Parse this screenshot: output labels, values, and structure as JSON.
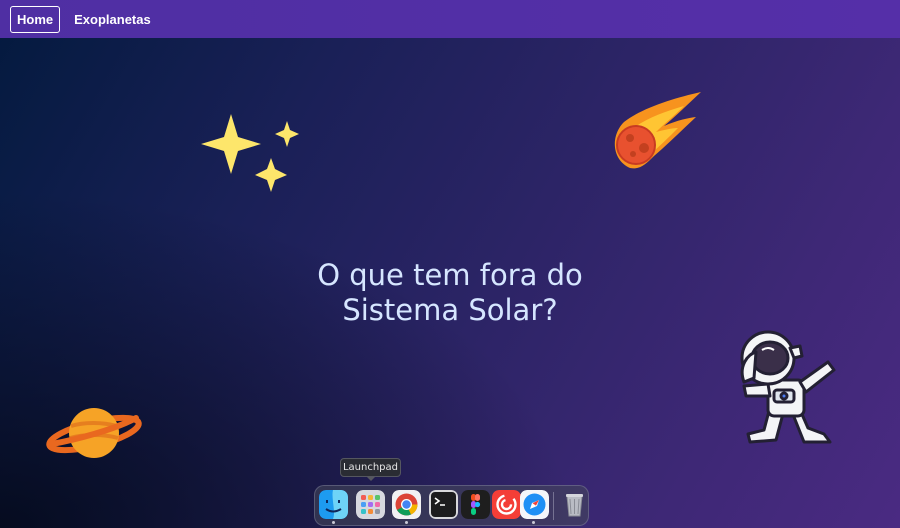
{
  "nav": {
    "home_label": "Home",
    "exoplanets_label": "Exoplanetas"
  },
  "hero": {
    "line1": "O que tem fora do",
    "line2": "Sistema Solar?"
  },
  "illustrations": [
    "sparkles-icon",
    "comet-icon",
    "saturn-icon",
    "astronaut-icon"
  ],
  "dock": {
    "tooltip": "Launchpad",
    "apps": [
      {
        "name": "Finder",
        "icon": "finder-icon",
        "running": true
      },
      {
        "name": "Launchpad",
        "icon": "launchpad-icon",
        "running": false
      },
      {
        "name": "Chrome",
        "icon": "chrome-icon",
        "running": true
      },
      {
        "name": "Terminal",
        "icon": "terminal-icon",
        "running": false
      },
      {
        "name": "Figma",
        "icon": "figma-icon",
        "running": false
      },
      {
        "name": "Pocket Casts",
        "icon": "podcast-icon",
        "running": false
      },
      {
        "name": "Safari",
        "icon": "safari-icon",
        "running": true
      },
      {
        "name": "Trash",
        "icon": "trash-icon",
        "running": false
      }
    ]
  },
  "colors": {
    "nav_bg": "#522fa6",
    "hero_text": "#d6e6ff",
    "background_start": "#031a3e",
    "background_end": "#4a2a82"
  }
}
